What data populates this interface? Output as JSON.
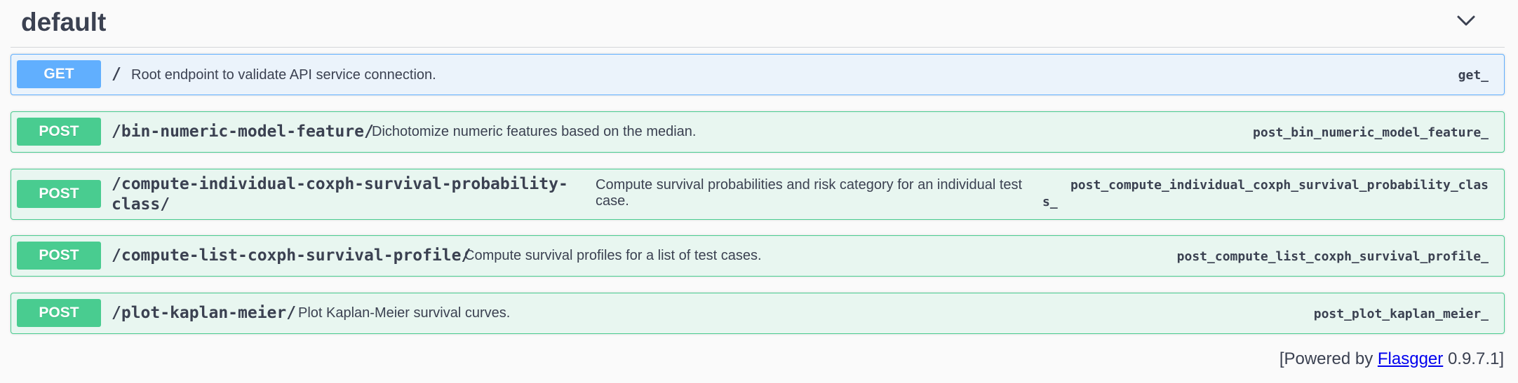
{
  "section": {
    "title": "default",
    "toggle_icon": "chevron-down-icon"
  },
  "operations": [
    {
      "method": "GET",
      "path": "/",
      "summary": "Root endpoint to validate API service connection.",
      "operation_id": "get_"
    },
    {
      "method": "POST",
      "path": "/bin-numeric-model-feature/",
      "summary": "Dichotomize numeric features based on the median.",
      "operation_id": "post_bin_numeric_model_feature_"
    },
    {
      "method": "POST",
      "path_line1": "/compute-individual-coxph-survival-probability-",
      "path_line2": "class/",
      "summary_line1": "Compute survival probabilities and risk category for an individual test",
      "summary_line2": "case.",
      "operation_id_line1": "post_compute_individual_coxph_survival_probability_clas",
      "operation_id_line2": "s_"
    },
    {
      "method": "POST",
      "path": "/compute-list-coxph-survival-profile/",
      "summary": "Compute survival profiles for a list of test cases.",
      "operation_id": "post_compute_list_coxph_survival_profile_"
    },
    {
      "method": "POST",
      "path": "/plot-kaplan-meier/",
      "summary": "Plot Kaplan-Meier survival curves.",
      "operation_id": "post_plot_kaplan_meier_"
    }
  ],
  "footer": {
    "prefix": "[Powered by",
    "link_text": "Flasgger",
    "suffix": "0.9.7.1]"
  },
  "colors": {
    "get": "#61affe",
    "post": "#49cc90",
    "text": "#3b4151"
  }
}
